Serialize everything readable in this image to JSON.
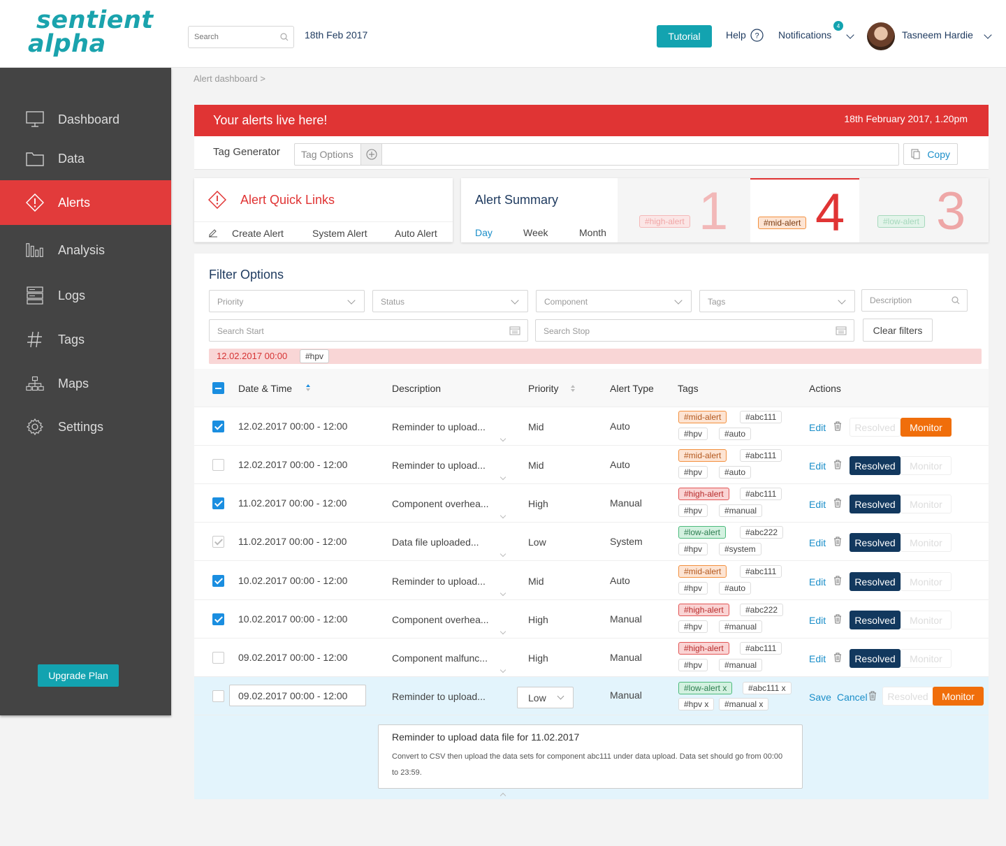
{
  "app": {
    "logo_line1": "sentient",
    "logo_line2": "alpha",
    "search_placeholder": "Search",
    "date": "18th Feb 2017",
    "tutorial": "Tutorial",
    "help": "Help",
    "notifications": "Notifications",
    "notifications_count": "4",
    "user_name": "Tasneem Hardie"
  },
  "sidebar": {
    "items": [
      {
        "label": "Dashboard",
        "icon": "monitor-icon"
      },
      {
        "label": "Data",
        "icon": "folder-icon"
      },
      {
        "label": "Alerts",
        "icon": "alert-diamond-icon"
      },
      {
        "label": "Analysis",
        "icon": "bar-chart-icon"
      },
      {
        "label": "Logs",
        "icon": "server-icon"
      },
      {
        "label": "Tags",
        "icon": "hash-icon"
      },
      {
        "label": "Maps",
        "icon": "sitemap-icon"
      },
      {
        "label": "Settings",
        "icon": "gear-icon"
      }
    ],
    "upgrade": "Upgrade Plan"
  },
  "breadcrumb": "Alert dashboard >",
  "banner": {
    "title": "Your alerts live here!",
    "date": "18th February 2017, 1.20pm"
  },
  "tag_generator": {
    "label": "Tag Generator",
    "options": "Tag Options",
    "copy": "Copy"
  },
  "quick_links": {
    "title": "Alert Quick Links",
    "items": [
      "Create Alert",
      "System Alert",
      "Auto Alert"
    ]
  },
  "summary": {
    "title": "Alert Summary",
    "tabs": [
      "Day",
      "Week",
      "Month"
    ],
    "counts": [
      {
        "tag": "#high-alert",
        "value": "1"
      },
      {
        "tag": "#mid-alert",
        "value": "4"
      },
      {
        "tag": "#low-alert",
        "value": "3"
      }
    ]
  },
  "filters": {
    "title": "Filter Options",
    "priority": "Priority",
    "status": "Status",
    "component": "Component",
    "tags": "Tags",
    "description": "Description",
    "search_start": "Search Start",
    "search_stop": "Search Stop",
    "clear": "Clear filters",
    "active_date": "12.02.2017 00:00",
    "active_tag": "#hpv"
  },
  "table": {
    "headers": {
      "datetime": "Date & Time",
      "description": "Description",
      "priority": "Priority",
      "alert_type": "Alert Type",
      "tags": "Tags",
      "actions": "Actions"
    },
    "rows": [
      {
        "dt": "12.02.2017  00:00 - 12:00",
        "desc": "Reminder to upload...",
        "pri": "Mid",
        "type": "Auto",
        "tags": [
          "#mid-alert",
          "#abc111",
          "#hpv",
          "#auto"
        ],
        "resolved_label": "Resolved",
        "monitor_label": "Monitor"
      },
      {
        "dt": "12.02.2017  00:00 - 12:00",
        "desc": "Reminder to upload...",
        "pri": "Mid",
        "type": "Auto",
        "tags": [
          "#mid-alert",
          "#abc111",
          "#hpv",
          "#auto"
        ],
        "resolved_label": "Resolved",
        "monitor_label": "Monitor"
      },
      {
        "dt": "11.02.2017  00:00 - 12:00",
        "desc": "Component overhea...",
        "pri": "High",
        "type": "Manual",
        "tags": [
          "#high-alert",
          "#abc111",
          "#hpv",
          "#manual"
        ],
        "resolved_label": "Resolved",
        "monitor_label": "Monitor"
      },
      {
        "dt": "11.02.2017  00:00 - 12:00",
        "desc": "Data file uploaded...",
        "pri": "Low",
        "type": "System",
        "tags": [
          "#low-alert",
          "#abc222",
          "#hpv",
          "#system"
        ],
        "resolved_label": "Resolved",
        "monitor_label": "Monitor"
      },
      {
        "dt": "10.02.2017  00:00 - 12:00",
        "desc": "Reminder to upload...",
        "pri": "Mid",
        "type": "Auto",
        "tags": [
          "#mid-alert",
          "#abc111",
          "#hpv",
          "#auto"
        ],
        "resolved_label": "Resolved",
        "monitor_label": "Monitor"
      },
      {
        "dt": "10.02.2017  00:00 - 12:00",
        "desc": "Component overhea...",
        "pri": "High",
        "type": "Manual",
        "tags": [
          "#high-alert",
          "#abc222",
          "#hpv",
          "#manual"
        ],
        "resolved_label": "Resolved",
        "monitor_label": "Monitor"
      },
      {
        "dt": "09.02.2017  00:00 - 12:00",
        "desc": "Component malfunc...",
        "pri": "High",
        "type": "Manual",
        "tags": [
          "#high-alert",
          "#abc111",
          "#hpv",
          "#manual"
        ],
        "resolved_label": "Resolved",
        "monitor_label": "Monitor"
      }
    ],
    "edit_label": "Edit",
    "edit_row": {
      "dt": "09.02.2017  00:00 - 12:00",
      "desc": "Reminder to upload...",
      "pri": "Low",
      "type": "Manual",
      "tags": [
        "#low-alert",
        "#abc111",
        "#hpv",
        "#manual"
      ],
      "save": "Save",
      "cancel": "Cancel",
      "resolved_label": "Resolved",
      "monitor_label": "Monitor"
    },
    "detail": {
      "heading": "Reminder to upload data file for 11.02.2017",
      "body": "Convert to CSV then upload the data sets for component abc111 under data upload. Data set should go from 00:00 to 23:59."
    }
  },
  "colors": {
    "brand": "#13a3b0",
    "alert_red": "#e03434",
    "navy": "#12385e",
    "orange": "#f06e0b"
  }
}
